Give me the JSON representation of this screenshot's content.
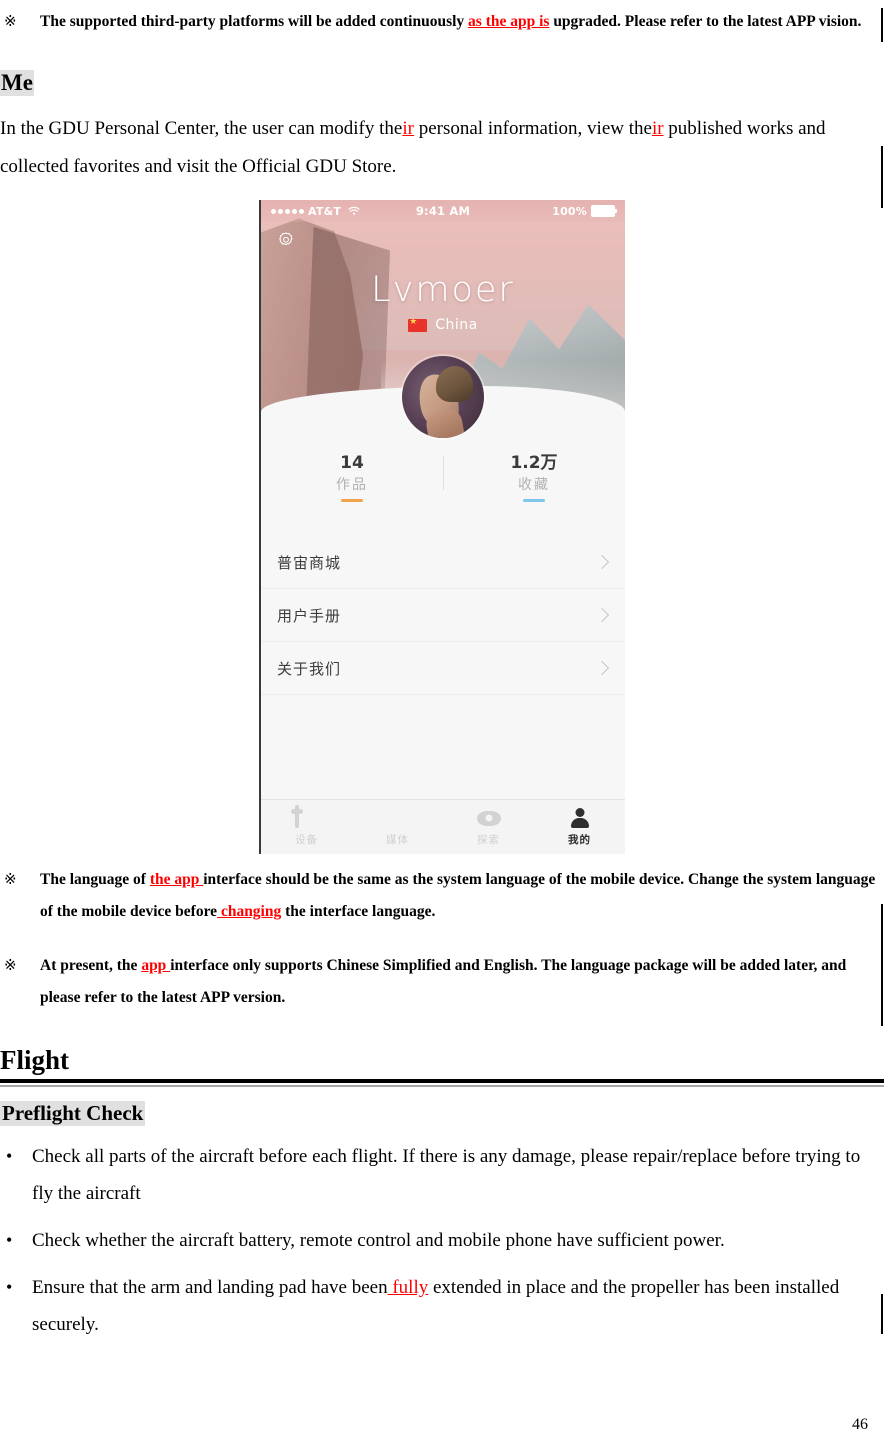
{
  "notes_top": [
    {
      "mark": "※",
      "segments": [
        {
          "text": "The supported third-party platforms will be added continuously ",
          "style": "normal"
        },
        {
          "text": "as the app is",
          "style": "red-ul"
        },
        {
          "text": " upgraded. Please refer to the latest APP vision.",
          "style": "normal"
        }
      ]
    }
  ],
  "me_section": {
    "heading": "Me",
    "paragraph": {
      "part1": "In the GDU Personal Center, the user can modify the",
      "red1": "ir",
      "part2": " personal information, view the",
      "red2": "ir",
      "part3": " published works and collected favorites and visit the Official GDU Store."
    }
  },
  "phone": {
    "status_bar": {
      "carrier": "AT&T",
      "time": "9:41 AM",
      "battery_percent": "100%"
    },
    "settings_icon": "gear-icon",
    "profile": {
      "username": "Lvmoer",
      "country": "China",
      "flag": "china-flag-icon"
    },
    "stats": [
      {
        "value": "14",
        "label": "作品",
        "accent": "#eea44a"
      },
      {
        "value": "1.2万",
        "label": "收藏",
        "accent": "#7fc6e8"
      }
    ],
    "menu": [
      {
        "label": "普宙商城"
      },
      {
        "label": "用户手册"
      },
      {
        "label": "关于我们"
      }
    ],
    "tabs": [
      {
        "label": "设备",
        "icon": "device-icon",
        "active": false
      },
      {
        "label": "媒体",
        "icon": "media-icon",
        "active": false
      },
      {
        "label": "探索",
        "icon": "eye-icon",
        "active": false
      },
      {
        "label": "我的",
        "icon": "person-icon",
        "active": true
      }
    ]
  },
  "notes_bottom": [
    {
      "mark": "※",
      "p1_a": "The language of ",
      "p1_red": "the app ",
      "p1_b": "interface should be the same as the system language of the mobile device. Change the system language of the mobile device before",
      "p1_red2": " changing",
      "p1_c": " the interface language."
    },
    {
      "mark": "※",
      "p1_a": "At present, the ",
      "p1_red": "app ",
      "p1_b": "interface only supports Chinese Simplified and English. The language package will be added later, and please refer to the latest APP version."
    }
  ],
  "flight_section": {
    "heading": "Flight",
    "subheading": "Preflight Check",
    "bullets": [
      {
        "a": "Check all parts of the aircraft before each flight. If there is any damage, please repair/replace before trying to fly the aircraft",
        "red": "",
        "b": ""
      },
      {
        "a": "Check whether the aircraft battery, remote control and mobile phone have sufficient power.",
        "red": "",
        "b": ""
      },
      {
        "a": "Ensure that the arm and landing pad have been",
        "red": " fully",
        "b": " extended in place and the propeller has been installed securely."
      }
    ]
  },
  "page_number": "46",
  "bullet_char": "•"
}
